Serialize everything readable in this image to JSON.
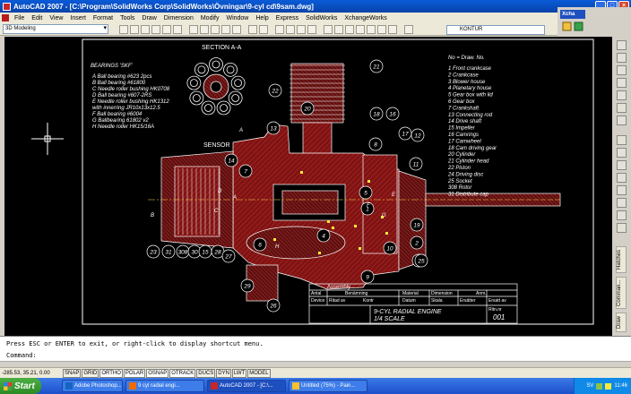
{
  "window": {
    "title": "AutoCAD 2007 - [C:\\Program\\SolidWorks Corp\\SolidWorks\\Övningar\\9-cyl cd\\9sam.dwg]",
    "min_label": "_",
    "max_label": "□",
    "close_label": "×"
  },
  "menu": {
    "items": [
      "File",
      "Edit",
      "View",
      "Insert",
      "Format",
      "Tools",
      "Draw",
      "Dimension",
      "Modify",
      "Window",
      "Help",
      "Express",
      "SolidWorks",
      "XchangeWorks"
    ]
  },
  "side_panel": {
    "xchange_label": "Xcha"
  },
  "toolbar": {
    "workspace": "3D Modeling",
    "layer": "KONTUR"
  },
  "drawing": {
    "section_title": "SECTION A-A",
    "sensor_label": "SENSOR",
    "bearings": {
      "title": "BEARINGS 'SKF'",
      "items": [
        "A  Ball bearing #623 2pcs",
        "B  Ball bearing #61800",
        "C  Needle roller bushing HK0708",
        "D  Ball bearing #607-2RS",
        "E  Needle roller bushing HK1312",
        "     with innerring JR10x13x12.5",
        "F  Ball bearing #6004",
        "G  Ballbearing 61802 v2",
        "H  Needle roller HK15/16A"
      ]
    },
    "parts_header": "No = Draw. No.",
    "parts": [
      "1  Front crankcase",
      "2  Crankcase",
      "3  Blower house",
      "4  Planetary house",
      "5  Gear box with lid",
      "6  Gear box",
      "7  Crankshaft",
      "13  Connecting rod",
      "14  Drive shaft",
      "15  Impeller",
      "16  Camrings",
      "17  Camwheel",
      "18  Cam driving gear",
      "20  Cylinder",
      "21  Cylinder head",
      "22  Piston",
      "24  Driving disc",
      "25  Socket",
      "308  Rotor",
      "31  Distribute cap"
    ],
    "balloons": [
      "21",
      "22",
      "20",
      "13",
      "18",
      "16",
      "17",
      "12",
      "8",
      "14",
      "7",
      "11",
      "5",
      "1",
      "2",
      "19",
      "10",
      "6",
      "4",
      "9",
      "3",
      "25",
      "23",
      "31",
      "308",
      "30",
      "29",
      "15",
      "28",
      "27",
      "26"
    ],
    "section_letters": [
      "A",
      "A",
      "B",
      "C",
      "H",
      "F",
      "G",
      "E",
      "D"
    ],
    "title_block": {
      "assembly": "Assembly",
      "headers": [
        "Antal",
        "Benämning",
        "Material",
        "Dimension",
        "Anm."
      ],
      "device": "Device",
      "row2": [
        "Ritad av",
        "Kontr",
        "Datum",
        "Skala",
        "Ersätter",
        "Ersatt av"
      ],
      "title_line1": "9-CYL RADIAL ENGINE",
      "title_line2": "1/4 SCALE",
      "drawing_no_label": "Ritn.nr",
      "drawing_no": "001"
    }
  },
  "right_tabs": [
    "Hatches",
    "Comman...",
    "Draw"
  ],
  "command": {
    "line1": "Press ESC or ENTER to exit, or right-click to display shortcut menu.",
    "line2": "Command:"
  },
  "status": {
    "coords": "-285.53, 35.21, 0.00",
    "buttons": [
      "SNAP",
      "GRID",
      "ORTHO",
      "POLAR",
      "OSNAP",
      "OTRACK",
      "DUCS",
      "DYN",
      "LWT",
      "MODEL"
    ]
  },
  "taskbar": {
    "start": "Start",
    "tasks": [
      "Adobe Photoshop...",
      "9 cyl radial engi...",
      "AutoCAD 2007 - [C:\\...",
      "Untitled (75%) - Pain..."
    ],
    "lang": "SV",
    "clock": "11:46"
  },
  "colors": {
    "title_blue": "#0842a8",
    "cad_background": "#000000",
    "hatch_red": "#9c1b1b",
    "line_white": "#ffffff",
    "taskbar_blue": "#1c4fcb",
    "start_green": "#2d8a24"
  }
}
